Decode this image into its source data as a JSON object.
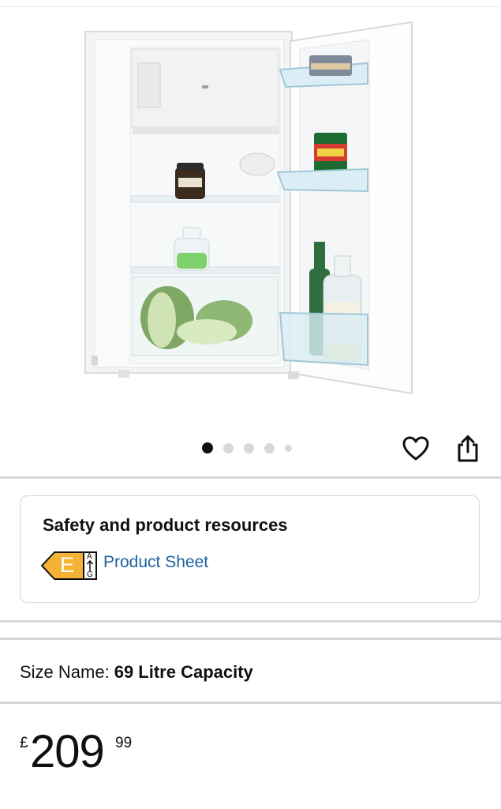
{
  "product": {
    "image_alt": "fridge-product-image",
    "carousel": {
      "total": 5,
      "active": 1
    }
  },
  "icons": {
    "favorite": "heart-icon",
    "share": "share-icon"
  },
  "resources": {
    "title": "Safety and product resources",
    "energy_class": "E",
    "energy_scale_top": "A",
    "energy_scale_bottom": "G",
    "energy_color": "#f5b335",
    "link_label": "Product Sheet"
  },
  "size": {
    "label": "Size Name:",
    "value": "69 Litre Capacity"
  },
  "price": {
    "currency": "£",
    "whole": "209",
    "fraction": "99"
  },
  "colors": {
    "link": "#2162a1",
    "divider": "#d5d9d9",
    "text": "#0f1111"
  }
}
